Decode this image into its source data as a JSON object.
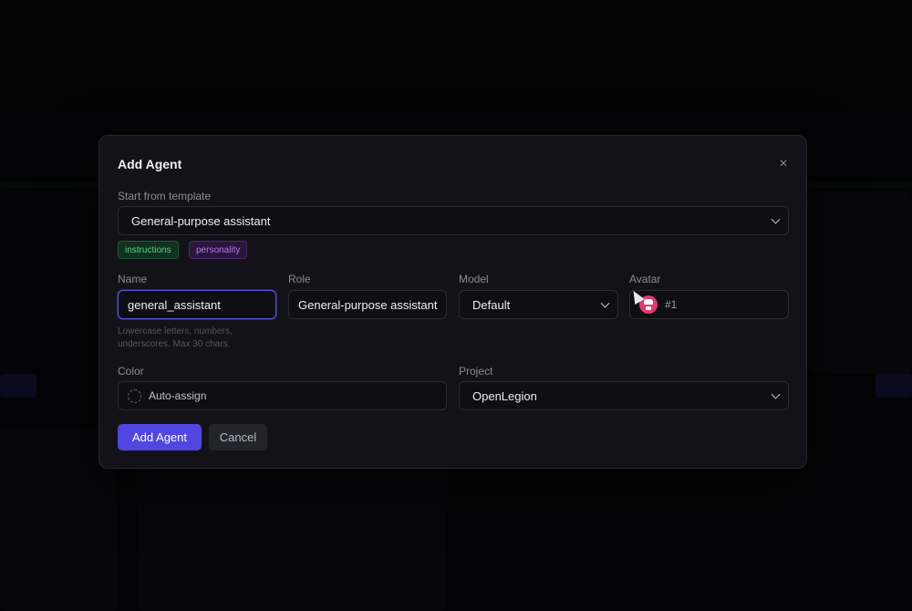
{
  "modal": {
    "title": "Add Agent",
    "close_icon": "close-icon"
  },
  "template": {
    "label": "Start from template",
    "value": "General-purpose assistant",
    "tags": [
      "instructions",
      "personality"
    ]
  },
  "name": {
    "label": "Name",
    "value": "general_assistant",
    "hint": "Lowercase letters, numbers, underscores. Max 30 chars."
  },
  "role": {
    "label": "Role",
    "value": "General-purpose assistant"
  },
  "model": {
    "label": "Model",
    "value": "Default"
  },
  "avatar": {
    "label": "Avatar",
    "value": "#1"
  },
  "color": {
    "label": "Color",
    "value": "Auto-assign"
  },
  "project": {
    "label": "Project",
    "value": "OpenLegion"
  },
  "buttons": {
    "add": "Add Agent",
    "cancel": "Cancel"
  },
  "colors": {
    "primary": "#5146e0",
    "tag_green": "#5fd08a",
    "tag_purple": "#b57be8",
    "avatar": "#e03a6e"
  }
}
